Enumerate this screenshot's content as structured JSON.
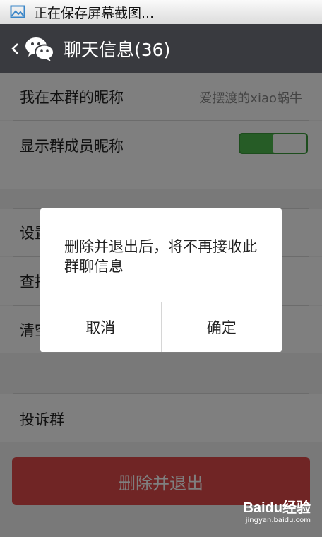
{
  "status_bar": {
    "text": "正在保存屏幕截图...",
    "icon": "image-icon"
  },
  "title_bar": {
    "back_icon": "chevron-left-icon",
    "app_icon": "wechat-icon",
    "title": "聊天信息(36)"
  },
  "settings": {
    "nickname_label": "我在本群的昵称",
    "nickname_value": "爱摆渡的xiao蜗牛",
    "show_nickname_label": "显示群成员昵称",
    "show_nickname_on": true,
    "row3_label": "设置当前聊天背景",
    "row4_label": "查找聊天记录",
    "row5_label": "清空聊天记录",
    "complaint_label": "投诉群"
  },
  "delete_button": {
    "label": "删除并退出"
  },
  "dialog": {
    "message": "删除并退出后，将不再接收此群聊信息",
    "cancel_label": "取消",
    "confirm_label": "确定"
  },
  "watermark": {
    "logo": "Baidu经验",
    "url": "jingyan.baidu.com"
  },
  "colors": {
    "title_bar": "#393a3f",
    "toggle_on": "#4cb84c",
    "delete_button": "#e04a4a"
  }
}
